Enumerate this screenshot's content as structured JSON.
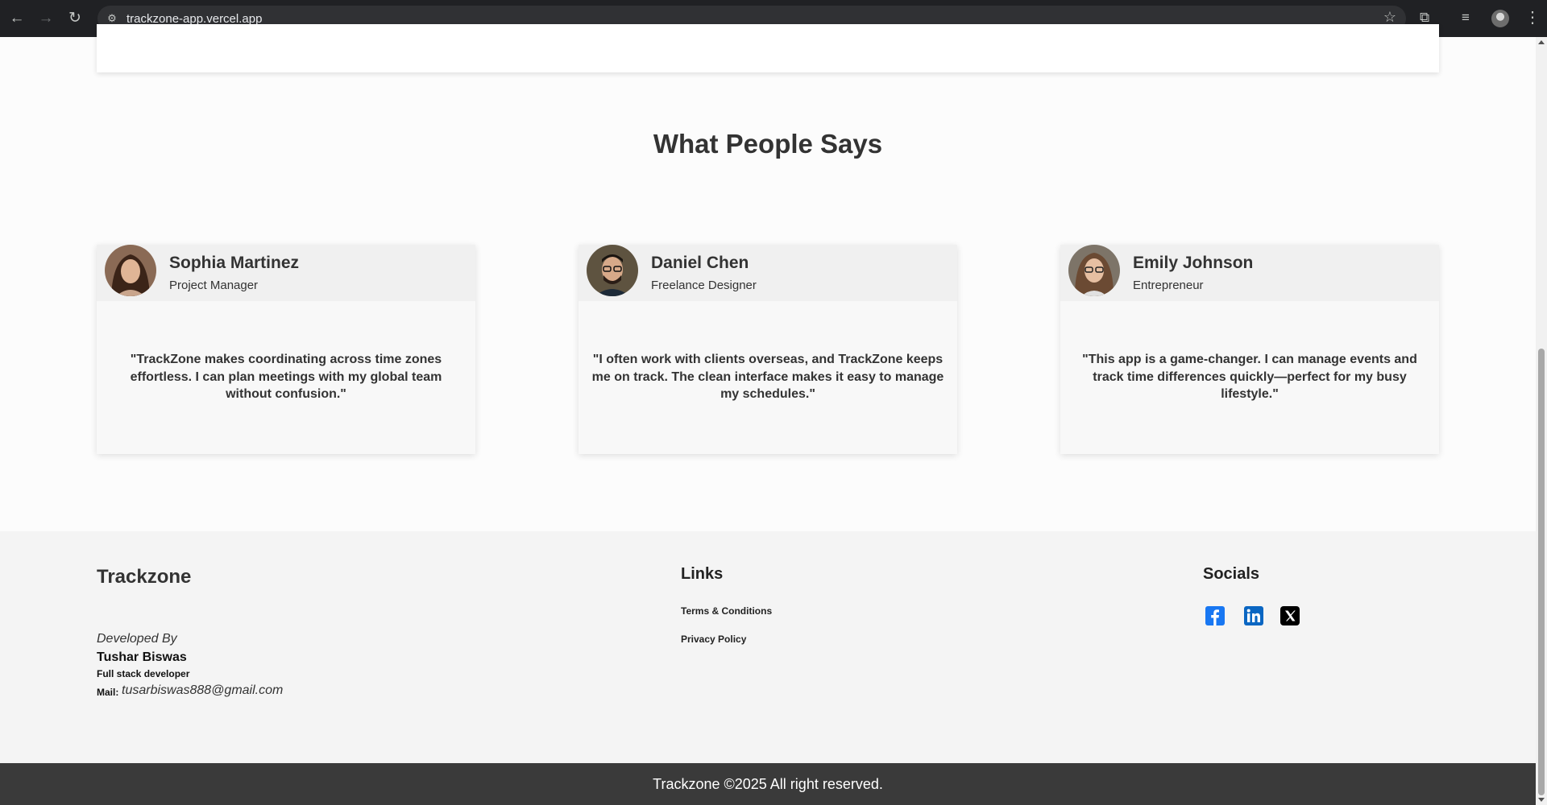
{
  "browser": {
    "url": "trackzone-app.vercel.app"
  },
  "testimonials": {
    "title": "What People Says",
    "items": [
      {
        "name": "Sophia Martinez",
        "role": "Project Manager",
        "quote": "\"TrackZone makes coordinating across time zones effortless. I can plan meetings with my global team without confusion.\""
      },
      {
        "name": "Daniel Chen",
        "role": "Freelance Designer",
        "quote": "\"I often work with clients overseas, and TrackZone keeps me on track. The clean interface makes it easy to manage my schedules.\""
      },
      {
        "name": "Emily Johnson",
        "role": "Entrepreneur",
        "quote": "\"This app is a game-changer. I can manage events and track time differences quickly—perfect for my busy lifestyle.\""
      }
    ]
  },
  "footer": {
    "brand": "Trackzone",
    "developed_by": "Developed By",
    "developer_name": "Tushar Biswas",
    "developer_role": "Full stack developer",
    "mail_label": "Mail:",
    "mail": "tusarbiswas888@gmail.com",
    "links_title": "Links",
    "links": [
      "Terms & Conditions",
      "Privacy Policy"
    ],
    "socials_title": "Socials",
    "socials": [
      "facebook-icon",
      "linkedin-icon",
      "x-icon"
    ],
    "copyright": "Trackzone ©2025 All right reserved."
  },
  "colors": {
    "facebook": "#1877f2",
    "linkedin": "#0a66c2",
    "x": "#000000",
    "bottom_bar": "#3a3a3a"
  }
}
